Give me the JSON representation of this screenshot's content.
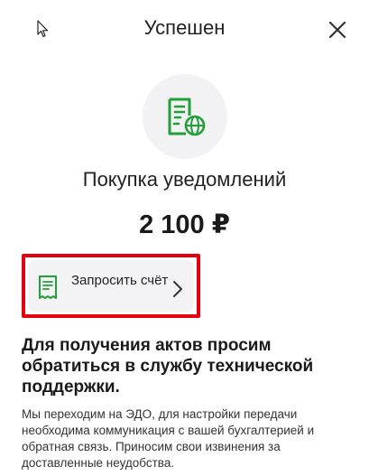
{
  "header": {
    "title": "Успешен"
  },
  "purchase": {
    "subtitle": "Покупка уведомлений",
    "amount": "2 100 ₽"
  },
  "invoice_button": {
    "label": "Запросить счёт"
  },
  "notice": {
    "heading": "Для получения актов просим обратиться в службу технической поддержки.",
    "body": "Мы переходим на ЭДО, для настройки передачи необходима коммуникация с вашей бухгалтерией и обратная связь. Приносим свои извинения за доставленные неудобства."
  },
  "colors": {
    "accent_green": "#21a038",
    "highlight_red": "#e4000f",
    "icon_bg": "#f2f2f4"
  },
  "icons": [
    "mouse-cursor-icon",
    "close-icon",
    "document-globe-icon",
    "receipt-icon",
    "chevron-right-icon"
  ]
}
